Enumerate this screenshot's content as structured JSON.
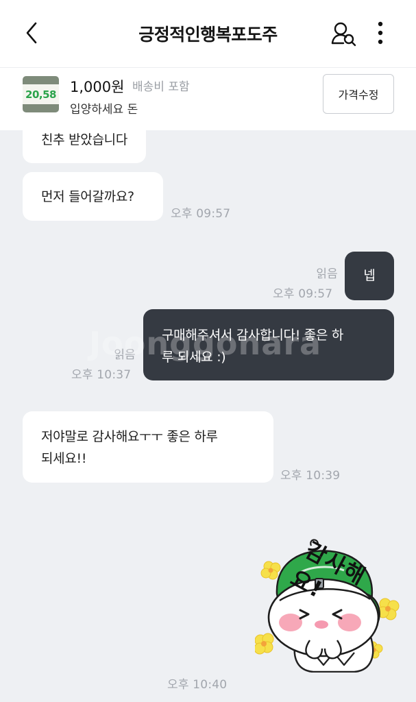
{
  "header": {
    "title": "긍정적인행복포도주",
    "back_icon": "chevron-left-icon",
    "user_search_icon": "user-search-icon",
    "more_icon": "more-vertical-icon"
  },
  "product": {
    "thumb_text": "20,58",
    "price": "1,000원",
    "shipping": "배송비 포함",
    "name": "입양하세요 돈",
    "edit_price_label": "가격수정"
  },
  "messages": [
    {
      "side": "in",
      "text": "친추 받았습니다"
    },
    {
      "side": "in",
      "text": "먼저 들어갈까요?",
      "time": "오후 09:57"
    },
    {
      "side": "out",
      "text": "넵",
      "read": "읽음",
      "time": "오후 09:57"
    },
    {
      "side": "out",
      "line1": "구매해주셔서 감사합니다! 좋은 하",
      "line2": "루 되세요 :)",
      "read": "읽음",
      "time": "오후 10:37"
    },
    {
      "side": "in",
      "line1": "저야말로 감사해요ㅜㅜ 좋은 하루",
      "line2": "되세요!!",
      "time": "오후 10:39"
    }
  ],
  "sticker": {
    "text": "감사해요!",
    "time": "오후 10:40"
  },
  "watermark": "Joonggonara",
  "colors": {
    "out_bubble": "#353a42",
    "chat_bg": "#eef0f3",
    "sticker_cap": "#2fa84a",
    "flower": "#f6e04a"
  }
}
